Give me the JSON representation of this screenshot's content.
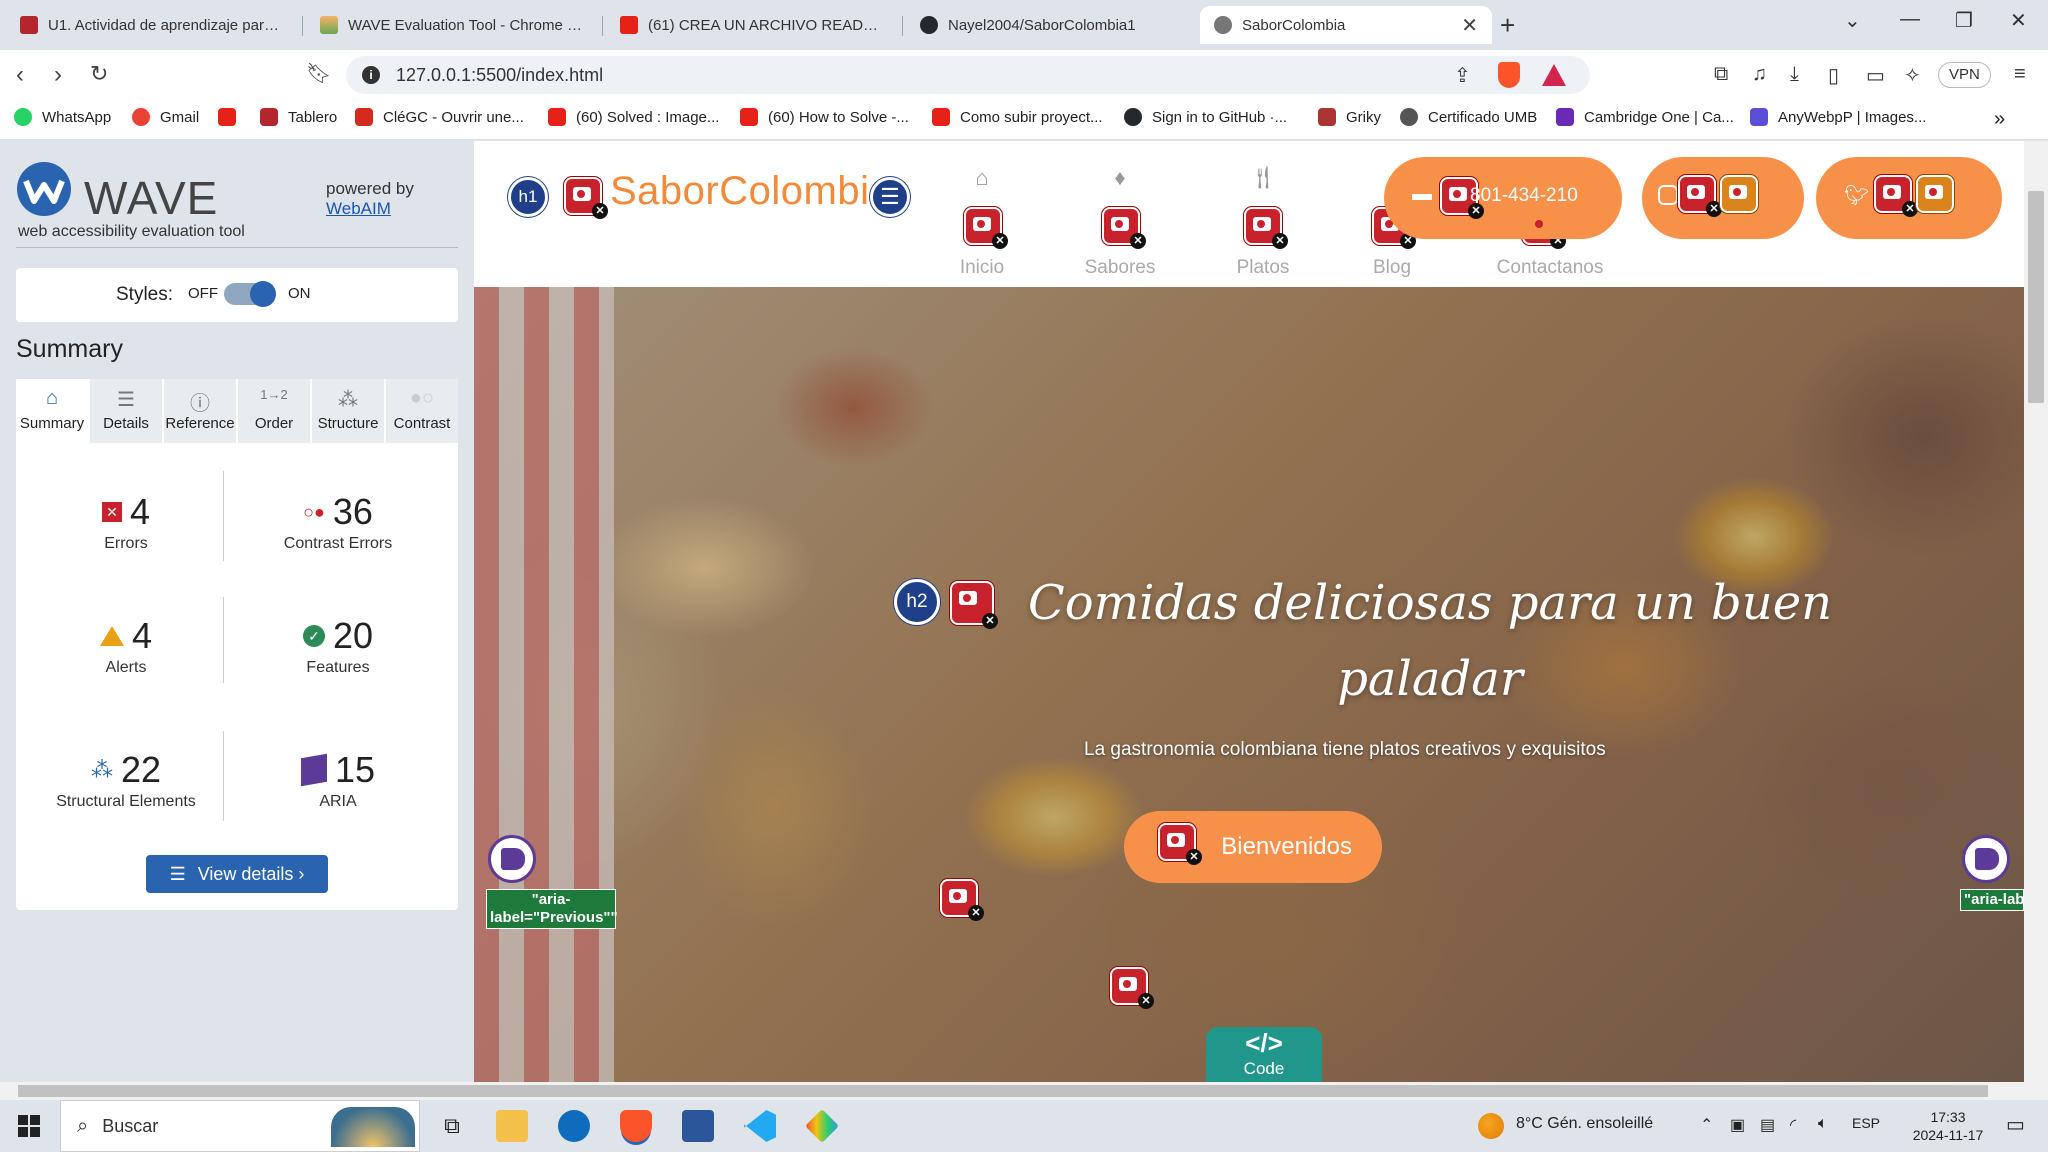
{
  "browser": {
    "tabs": [
      {
        "title": "U1. Actividad de aprendizaje para R",
        "color": "#b3262e"
      },
      {
        "title": "WAVE Evaluation Tool - Chrome We",
        "color": "#6aa84f"
      },
      {
        "title": "(61) CREA UN ARCHIVO README P",
        "color": "#e62117"
      },
      {
        "title": "Nayel2004/SaborColombia1",
        "color": "#24292e"
      },
      {
        "title": "SaborColombia",
        "color": "#666666"
      }
    ],
    "url": "127.0.0.1:5500/index.html",
    "vpn": "VPN",
    "bookmarks": [
      {
        "label": "WhatsApp",
        "color": "#25d366"
      },
      {
        "label": "Gmail",
        "color": "#ea4335"
      },
      {
        "label": "",
        "color": "#e62117"
      },
      {
        "label": "Tablero",
        "color": "#b3262e"
      },
      {
        "label": "CléGC - Ouvrir une...",
        "color": "#d52b1e"
      },
      {
        "label": "(60) Solved : Image...",
        "color": "#e62117"
      },
      {
        "label": "(60) How to Solve -...",
        "color": "#e62117"
      },
      {
        "label": "Como subir proyect...",
        "color": "#e62117"
      },
      {
        "label": "Sign in to GitHub ·...",
        "color": "#24292e"
      },
      {
        "label": "Griky",
        "color": "#a33"
      },
      {
        "label": "Certificado UMB",
        "color": "#555"
      },
      {
        "label": "Cambridge One | Ca...",
        "color": "#6a2ab5"
      },
      {
        "label": "AnyWebpP | Images...",
        "color": "#5b4fd6"
      }
    ]
  },
  "wave": {
    "title": "WAVE",
    "subtitle": "web accessibility evaluation tool",
    "powered": "powered by",
    "webaim": "WebAIM",
    "styles_label": "Styles:",
    "off": "OFF",
    "on": "ON",
    "summary_heading": "Summary",
    "tabs": [
      "Summary",
      "Details",
      "Reference",
      "Order",
      "Structure",
      "Contrast"
    ],
    "stats": {
      "errors": {
        "value": "4",
        "label": "Errors"
      },
      "contrast": {
        "value": "36",
        "label": "Contrast Errors"
      },
      "alerts": {
        "value": "4",
        "label": "Alerts"
      },
      "features": {
        "value": "20",
        "label": "Features"
      },
      "structural": {
        "value": "22",
        "label": "Structural Elements"
      },
      "aria": {
        "value": "15",
        "label": "ARIA"
      }
    },
    "view_details": "View details ›"
  },
  "site": {
    "brand": "SaborColombia",
    "nav": [
      "Inicio",
      "Sabores",
      "Platos",
      "Blog",
      "Contactanos"
    ],
    "phone": "801-434-210",
    "h1": "h1",
    "h2": "h2",
    "hero_title": "Comidas deliciosas para un buen paladar",
    "hero_sub": "La gastronomia colombiana tiene platos creativos y exquisitos",
    "hero_button": "Bienvenidos",
    "aria_prev": "\"aria-label=\"Previous\"\"",
    "aria_next": "\"aria-label=\"N",
    "code": "Code",
    "code_symbol": "</>"
  },
  "taskbar": {
    "search": "Buscar",
    "weather": "8°C  Gén. ensoleillé",
    "lang": "ESP",
    "time": "17:33",
    "date": "2024-11-17"
  }
}
